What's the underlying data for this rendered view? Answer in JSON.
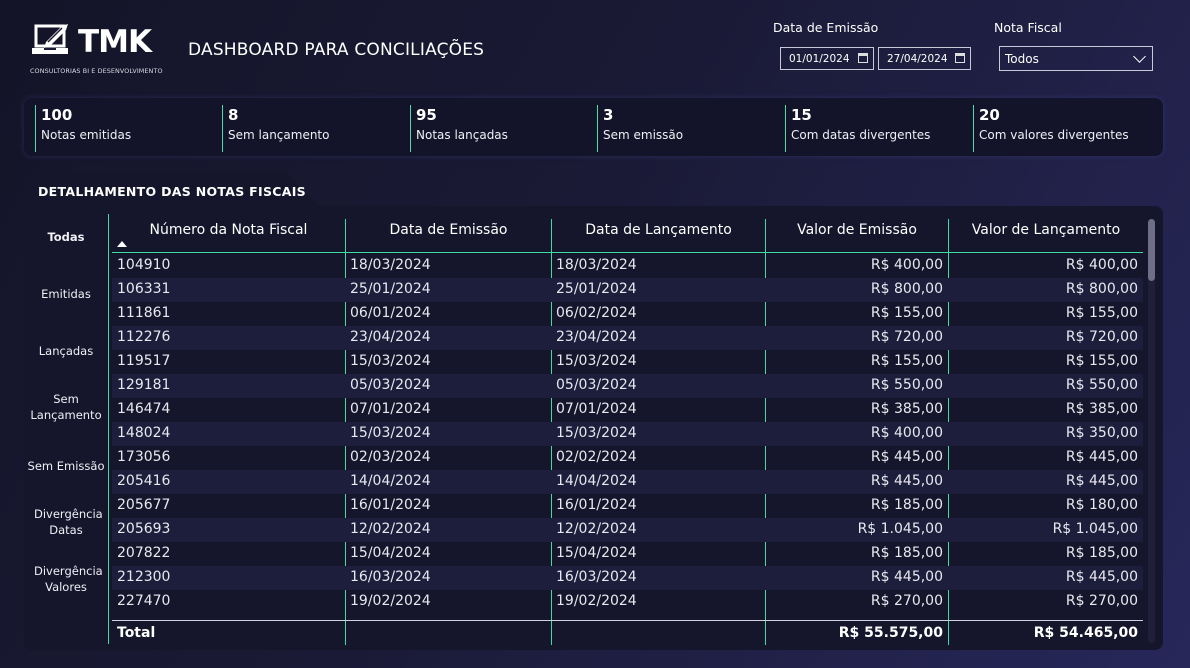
{
  "brand": {
    "name": "TMK",
    "tagline": "CONSULTORIAS BI E DESENVOLVIMENTO"
  },
  "header": {
    "title": "DASHBOARD PARA CONCILIAÇÕES"
  },
  "filters": {
    "date_label": "Data de Emissão",
    "date_from": "01/01/2024",
    "date_to": "27/04/2024",
    "nota_label": "Nota Fiscal",
    "nota_value": "Todos"
  },
  "kpis": [
    {
      "value": "100",
      "label": "Notas emitidas"
    },
    {
      "value": "8",
      "label": "Sem lançamento"
    },
    {
      "value": "95",
      "label": "Notas lançadas"
    },
    {
      "value": "3",
      "label": "Sem emissão"
    },
    {
      "value": "15",
      "label": "Com datas divergentes"
    },
    {
      "value": "20",
      "label": "Com valores divergentes"
    }
  ],
  "panel": {
    "title": "DETALHAMENTO DAS NOTAS FISCAIS"
  },
  "sidebar": {
    "items": [
      {
        "label": "Todas"
      },
      {
        "label": "Emitidas"
      },
      {
        "label": "Lançadas"
      },
      {
        "label": "Sem Lançamento"
      },
      {
        "label": "Sem Emissão"
      },
      {
        "label": "Divergência Datas"
      },
      {
        "label": "Divergência Valores"
      }
    ]
  },
  "table": {
    "columns": [
      "Número da Nota Fiscal",
      "Data de Emissão",
      "Data de Lançamento",
      "Valor de Emissão",
      "Valor de Lançamento"
    ],
    "rows": [
      [
        "104910",
        "18/03/2024",
        "18/03/2024",
        "R$ 400,00",
        "R$ 400,00"
      ],
      [
        "106331",
        "25/01/2024",
        "25/01/2024",
        "R$ 800,00",
        "R$ 800,00"
      ],
      [
        "111861",
        "06/01/2024",
        "06/02/2024",
        "R$ 155,00",
        "R$ 155,00"
      ],
      [
        "112276",
        "23/04/2024",
        "23/04/2024",
        "R$ 720,00",
        "R$ 720,00"
      ],
      [
        "119517",
        "15/03/2024",
        "15/03/2024",
        "R$ 155,00",
        "R$ 155,00"
      ],
      [
        "129181",
        "05/03/2024",
        "05/03/2024",
        "R$ 550,00",
        "R$ 550,00"
      ],
      [
        "146474",
        "07/01/2024",
        "07/01/2024",
        "R$ 385,00",
        "R$ 385,00"
      ],
      [
        "148024",
        "15/03/2024",
        "15/03/2024",
        "R$ 400,00",
        "R$ 350,00"
      ],
      [
        "173056",
        "02/03/2024",
        "02/02/2024",
        "R$ 445,00",
        "R$ 445,00"
      ],
      [
        "205416",
        "14/04/2024",
        "14/04/2024",
        "R$ 445,00",
        "R$ 445,00"
      ],
      [
        "205677",
        "16/01/2024",
        "16/01/2024",
        "R$ 185,00",
        "R$ 180,00"
      ],
      [
        "205693",
        "12/02/2024",
        "12/02/2024",
        "R$ 1.045,00",
        "R$ 1.045,00"
      ],
      [
        "207822",
        "15/04/2024",
        "15/04/2024",
        "R$ 185,00",
        "R$ 185,00"
      ],
      [
        "212300",
        "16/03/2024",
        "16/03/2024",
        "R$ 445,00",
        "R$ 445,00"
      ],
      [
        "227470",
        "19/02/2024",
        "19/02/2024",
        "R$ 270,00",
        "R$ 270,00"
      ]
    ],
    "total": {
      "label": "Total",
      "valor_emissao": "R$ 55.575,00",
      "valor_lancamento": "R$ 54.465,00"
    }
  },
  "colors": {
    "accent": "#3ddba0",
    "panel": "#15152c",
    "background": "#1a1a36"
  }
}
